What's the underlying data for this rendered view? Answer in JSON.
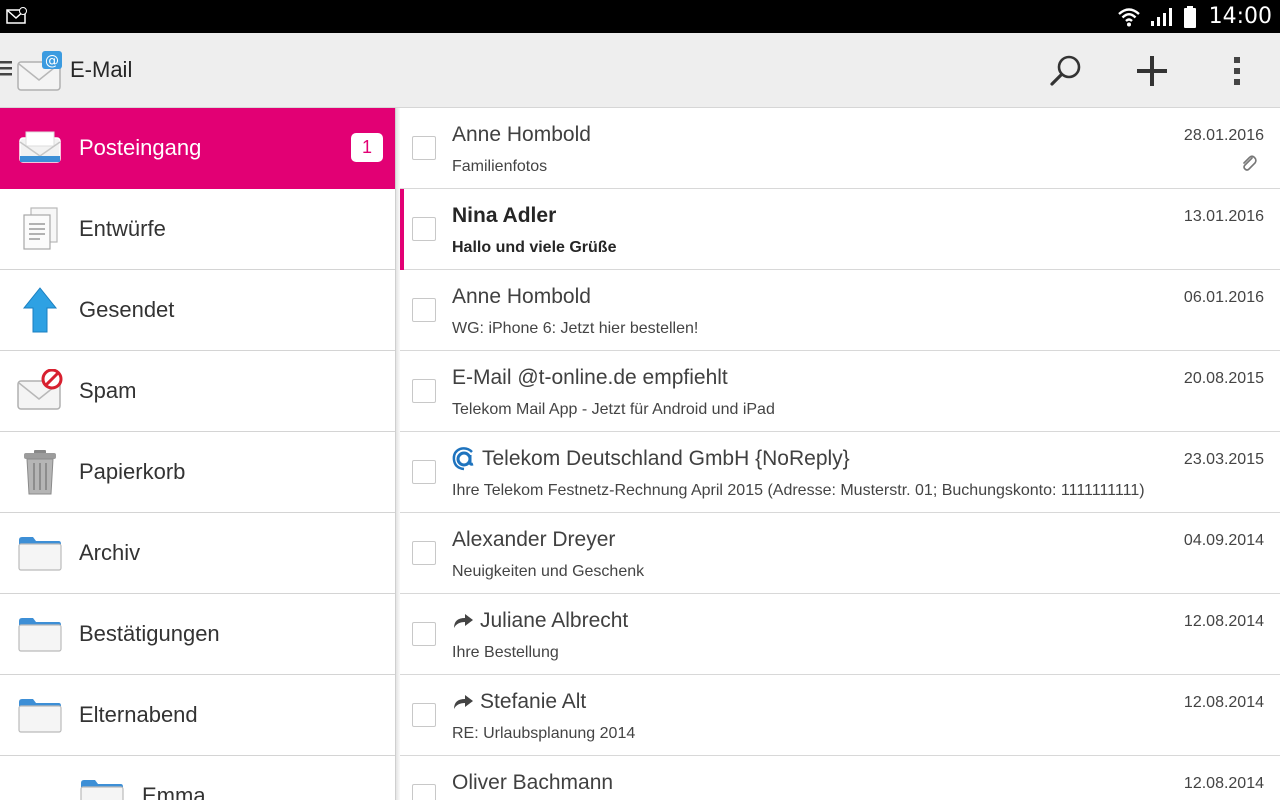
{
  "statusbar": {
    "time": "14:00",
    "icons": [
      "notification-mail-icon",
      "wifi-icon",
      "signal-icon",
      "battery-icon"
    ]
  },
  "appbar": {
    "title": "E-Mail",
    "actions": [
      "search-icon",
      "add-icon",
      "overflow-menu-icon"
    ]
  },
  "colors": {
    "accent": "#e20074",
    "appbar_bg": "#eeeeee"
  },
  "sidebar": {
    "items": [
      {
        "label": "Posteingang",
        "icon": "inbox-icon",
        "badge": "1"
      },
      {
        "label": "Entwürfe",
        "icon": "drafts-icon"
      },
      {
        "label": "Gesendet",
        "icon": "sent-arrow-icon"
      },
      {
        "label": "Spam",
        "icon": "spam-icon"
      },
      {
        "label": "Papierkorb",
        "icon": "trash-icon"
      },
      {
        "label": "Archiv",
        "icon": "folder-icon"
      },
      {
        "label": "Bestätigungen",
        "icon": "folder-icon"
      },
      {
        "label": "Elternabend",
        "icon": "folder-icon"
      },
      {
        "label": "Emma",
        "icon": "folder-icon"
      }
    ]
  },
  "mails": [
    {
      "sender": "Anne Hombold",
      "subject": "Familienfotos",
      "date": "28.01.2016",
      "attachment": true
    },
    {
      "sender": "Nina Adler",
      "subject": "Hallo und viele Grüße",
      "date": "13.01.2016",
      "unread": true
    },
    {
      "sender": "Anne Hombold",
      "subject": "WG: iPhone 6: Jetzt hier bestellen!",
      "date": "06.01.2016"
    },
    {
      "sender": "E-Mail @t-online.de empfiehlt",
      "subject": "Telekom Mail App - Jetzt für Android und iPad",
      "date": "20.08.2015"
    },
    {
      "sender": "Telekom Deutschland GmbH {NoReply}",
      "subject": "Ihre Telekom Festnetz-Rechnung April 2015 (Adresse: Musterstr. 01; Buchungskonto: 1111111111)",
      "date": "23.03.2015",
      "icon": "verified-at-icon"
    },
    {
      "sender": "Alexander Dreyer",
      "subject": "Neuigkeiten und Geschenk",
      "date": "04.09.2014"
    },
    {
      "sender": "Juliane Albrecht",
      "subject": "Ihre Bestellung",
      "date": "12.08.2014",
      "icon": "forwarded-icon"
    },
    {
      "sender": "Stefanie Alt",
      "subject": "RE: Urlaubsplanung 2014",
      "date": "12.08.2014",
      "icon": "forwarded-icon"
    },
    {
      "sender": "Oliver Bachmann",
      "subject": "",
      "date": "12.08.2014"
    }
  ]
}
